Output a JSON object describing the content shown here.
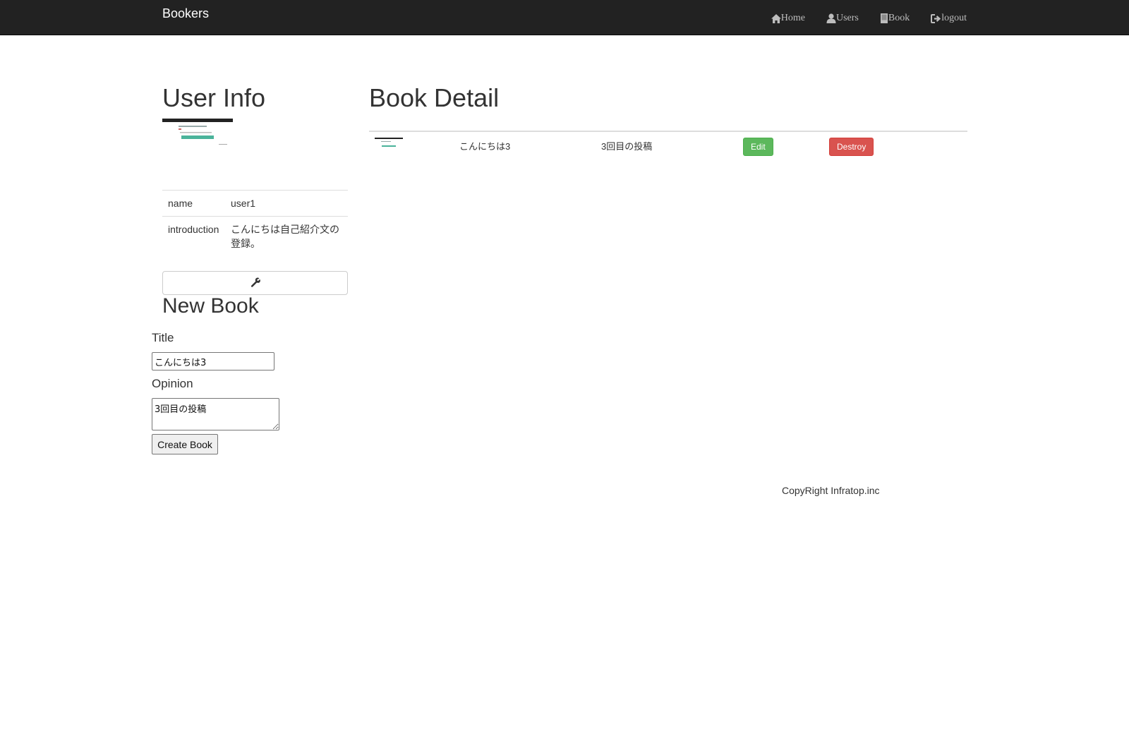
{
  "navbar": {
    "brand": "Bookers",
    "links": [
      {
        "label": "Home",
        "icon": "home-icon"
      },
      {
        "label": "Users",
        "icon": "user-icon"
      },
      {
        "label": "Book",
        "icon": "book-icon"
      },
      {
        "label": "logout",
        "icon": "logout-icon"
      }
    ]
  },
  "user_info": {
    "heading": "User Info",
    "rows": [
      {
        "key": "name",
        "value": "user1"
      },
      {
        "key": "introduction",
        "value": "こんにちは自己紹介文の登録。"
      }
    ],
    "edit_icon": "wrench-icon"
  },
  "new_book": {
    "heading": "New Book",
    "title_label": "Title",
    "title_value": "こんにちは3",
    "opinion_label": "Opinion",
    "opinion_value": "3回目の投稿",
    "submit_label": "Create Book"
  },
  "book_detail": {
    "heading": "Book Detail",
    "row": {
      "title": "こんにちは3",
      "opinion": "3回目の投稿",
      "edit_label": "Edit",
      "destroy_label": "Destroy"
    }
  },
  "footer": {
    "text": "CopyRight Infratop.inc"
  },
  "colors": {
    "navbar_bg": "#222222",
    "edit_button": "#5cb85c",
    "destroy_button": "#d9534f"
  }
}
